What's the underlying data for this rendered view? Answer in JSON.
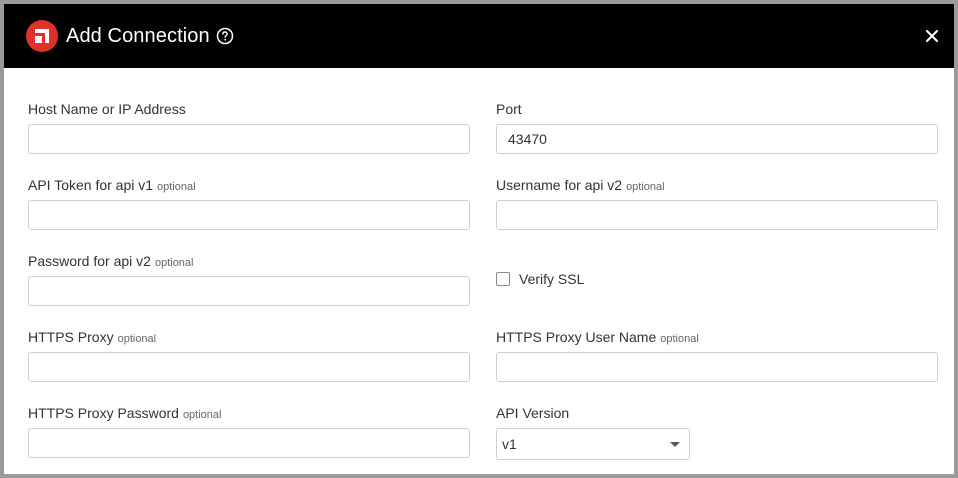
{
  "dialog": {
    "title": "Add Connection",
    "icons": {
      "logo": "brand-logo-icon",
      "help": "help-circle-icon",
      "close": "close-icon"
    },
    "colors": {
      "header_bg": "#000000",
      "logo": "#e0302a"
    }
  },
  "fields": {
    "host": {
      "label": "Host Name or IP Address",
      "value": ""
    },
    "port": {
      "label": "Port",
      "value": "43470"
    },
    "api_token": {
      "label": "API Token for api v1",
      "optional": "optional",
      "value": ""
    },
    "username": {
      "label": "Username for api v2",
      "optional": "optional",
      "value": ""
    },
    "password": {
      "label": "Password for api v2",
      "optional": "optional",
      "value": ""
    },
    "verify_ssl": {
      "label": "Verify SSL",
      "checked": false
    },
    "https_proxy": {
      "label": "HTTPS Proxy",
      "optional": "optional",
      "value": ""
    },
    "proxy_user": {
      "label": "HTTPS Proxy User Name",
      "optional": "optional",
      "value": ""
    },
    "proxy_password": {
      "label": "HTTPS Proxy Password",
      "optional": "optional",
      "value": ""
    },
    "api_version": {
      "label": "API Version",
      "selected": "v1"
    }
  }
}
